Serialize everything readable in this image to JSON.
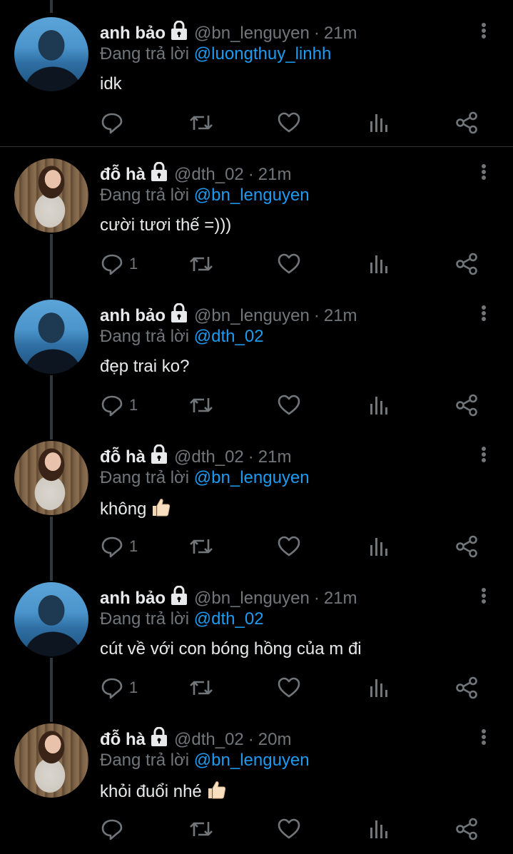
{
  "tweets": [
    {
      "name": "anh bảo",
      "handle": "@bn_lenguyen",
      "time": "21m",
      "replying_prefix": "Đang trả lời",
      "replying_to": "@luongthuy_linhh",
      "text": "idk",
      "emoji": "",
      "replies": "",
      "avatar": "blue"
    },
    {
      "name": "đỗ hà",
      "handle": "@dth_02",
      "time": "21m",
      "replying_prefix": "Đang trả lời",
      "replying_to": "@bn_lenguyen",
      "text": "cười tươi thế =)))",
      "emoji": "",
      "replies": "1",
      "avatar": "girl"
    },
    {
      "name": "anh bảo",
      "handle": "@bn_lenguyen",
      "time": "21m",
      "replying_prefix": "Đang trả lời",
      "replying_to": "@dth_02",
      "text": "đẹp trai ko?",
      "emoji": "",
      "replies": "1",
      "avatar": "blue"
    },
    {
      "name": "đỗ hà",
      "handle": "@dth_02",
      "time": "21m",
      "replying_prefix": "Đang trả lời",
      "replying_to": "@bn_lenguyen",
      "text": "không",
      "emoji": "thumbs-up",
      "replies": "1",
      "avatar": "girl"
    },
    {
      "name": "anh bảo",
      "handle": "@bn_lenguyen",
      "time": "21m",
      "replying_prefix": "Đang trả lời",
      "replying_to": "@dth_02",
      "text": "cút về với con bóng hồng của m đi",
      "emoji": "",
      "replies": "1",
      "avatar": "blue"
    },
    {
      "name": "đỗ hà",
      "handle": "@dth_02",
      "time": "20m",
      "replying_prefix": "Đang trả lời",
      "replying_to": "@bn_lenguyen",
      "text": "khỏi đuổi nhé",
      "emoji": "thumbs-up",
      "replies": "",
      "avatar": "girl"
    }
  ],
  "icons": {
    "reply": "reply-icon",
    "retweet": "retweet-icon",
    "like": "heart-icon",
    "views": "analytics-icon",
    "share": "share-icon",
    "lock": "lock-icon",
    "more": "more-vertical-icon"
  },
  "colors": {
    "background": "#000000",
    "accent": "#1d9bf0",
    "muted": "#71767b",
    "text": "#e7e9ea"
  }
}
